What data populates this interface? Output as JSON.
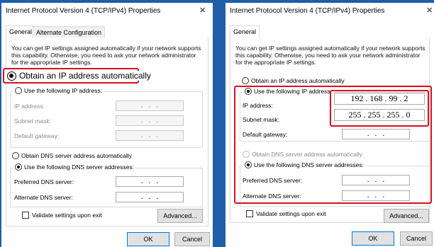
{
  "left": {
    "title": "Internet Protocol Version 4 (TCP/IPv4) Properties",
    "close": "×",
    "tabs": [
      "General",
      "Alternate Configuration"
    ],
    "intro": "You can get IP settings assigned automatically if your network supports this capability. Otherwise, you need to ask your network administrator for the appropriate IP settings.",
    "obtain_ip_auto": "Obtain an IP address automatically",
    "use_following_ip": "Use the following IP address:",
    "ip_address_label": "IP address:",
    "subnet_mask_label": "Subnet mask:",
    "default_gateway_label": "Default gateway:",
    "empty_ip": ".       .       .",
    "obtain_dns_auto": "Obtain DNS server address automatically",
    "use_following_dns": "Use the following DNS server addresses:",
    "preferred_dns_label": "Preferred DNS server:",
    "alternate_dns_label": "Alternate DNS server:",
    "validate_label": "Validate settings upon exit",
    "advanced_button": "Advanced...",
    "ok_button": "OK",
    "cancel_button": "Cancel"
  },
  "right": {
    "title": "Internet Protocol Version 4 (TCP/IPv4) Properties",
    "close": "×",
    "tabs": [
      "General"
    ],
    "intro": "You can get IP settings assigned automatically if your network supports this capability. Otherwise, you need to ask your network administrator for the appropriate IP settings.",
    "obtain_ip_auto": "Obtain an IP address automatically",
    "use_following_ip": "Use the following IP address:",
    "ip_address_label": "IP address:",
    "ip_address_value": "192 . 168 . 99 . 2",
    "subnet_mask_label": "Subnet mask:",
    "subnet_mask_value": "255 . 255 . 255 . 0",
    "default_gateway_label": "Default gateway:",
    "empty_ip": ".       .       .",
    "obtain_dns_auto": "Obtain DNS server address automatically",
    "use_following_dns": "Use the following DNS server addresses:",
    "preferred_dns_label": "Preferred DNS server:",
    "alternate_dns_label": "Alternate DNS server:",
    "validate_label": "Validate settings upon exit",
    "advanced_button": "Advanced...",
    "ok_button": "OK",
    "cancel_button": "Cancel"
  },
  "colors": {
    "background": "#1f5ea8",
    "highlight": "#d9101f",
    "default_button_border": "#0078d7"
  }
}
